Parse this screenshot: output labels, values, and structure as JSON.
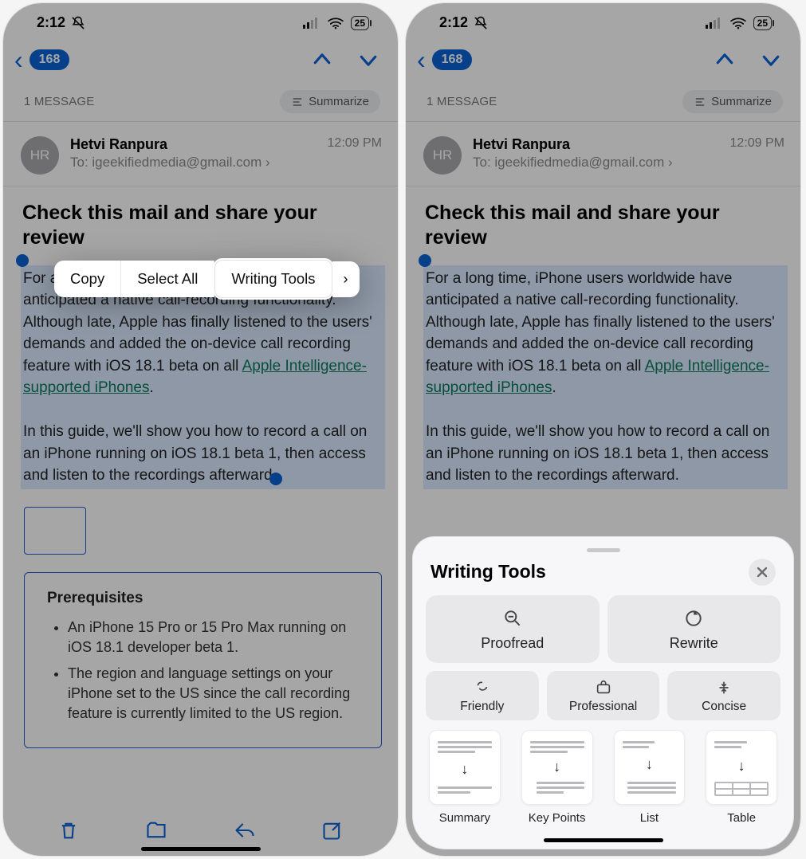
{
  "status": {
    "time": "2:12",
    "battery": "25"
  },
  "nav": {
    "back_count": "168"
  },
  "thread": {
    "count_label": "1 MESSAGE",
    "summarize_label": "Summarize"
  },
  "sender": {
    "initials": "HR",
    "name": "Hetvi Ranpura",
    "time": "12:09 PM",
    "to_prefix": "To: ",
    "to_email": "igeekifiedmedia@gmail.com"
  },
  "subject": "Check this mail and share your review",
  "body": {
    "p1a": "For a long time, iPhone users worldwide have anticipated a native call-recording functionality. Although late, Apple has finally listened to the users' demands and added the on-device call recording feature with iOS 18.1 beta on all ",
    "link": "Apple Intelligence-supported iPhones",
    "p1b": ".",
    "p2": "In this guide, we'll show you how to record a call on an iPhone running on iOS 18.1 beta 1, then access and listen to the recordings afterward."
  },
  "prereq": {
    "title": "Prerequisites",
    "items": [
      "An iPhone 15 Pro or 15 Pro Max running on iOS 18.1 developer beta 1.",
      "The region and language settings on your iPhone set to the US since the call recording feature is currently limited to the US region."
    ]
  },
  "context_menu": {
    "copy": "Copy",
    "select_all": "Select All",
    "writing_tools": "Writing Tools"
  },
  "sheet": {
    "title": "Writing Tools",
    "proofread": "Proofread",
    "rewrite": "Rewrite",
    "friendly": "Friendly",
    "professional": "Professional",
    "concise": "Concise",
    "summary": "Summary",
    "key_points": "Key Points",
    "list": "List",
    "table": "Table"
  }
}
